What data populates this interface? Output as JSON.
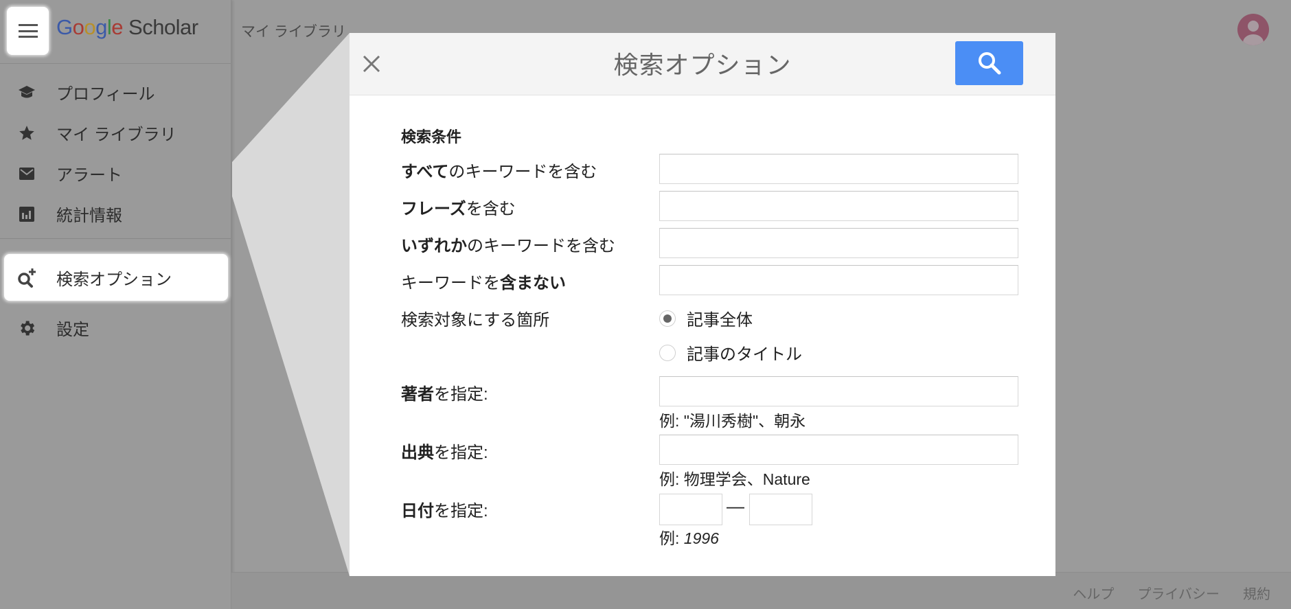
{
  "app": {
    "logo_google": [
      "G",
      "o",
      "o",
      "g",
      "l",
      "e"
    ],
    "logo_product": "Scholar",
    "header_library_link": "マイ ライブラリ"
  },
  "sidebar": {
    "items": [
      {
        "label": "プロフィール",
        "icon": "graduation-cap-icon"
      },
      {
        "label": "マイ ライブラリ",
        "icon": "star-icon"
      },
      {
        "label": "アラート",
        "icon": "envelope-icon"
      },
      {
        "label": "統計情報",
        "icon": "bar-chart-icon"
      },
      {
        "label": "検索オプション",
        "icon": "search-plus-icon",
        "active": true
      },
      {
        "label": "設定",
        "icon": "gear-icon"
      }
    ]
  },
  "footer": {
    "links": [
      "ヘルプ",
      "プライバシー",
      "規約"
    ]
  },
  "modal": {
    "title": "検索オプション",
    "close_icon": "close-icon",
    "search_icon": "search-icon",
    "section_title": "検索条件",
    "fields": [
      {
        "label_bold": "すべて",
        "label_rest": "のキーワードを含む",
        "value": "",
        "placeholder": ""
      },
      {
        "label_bold": "フレーズ",
        "label_rest": "を含む",
        "value": "",
        "placeholder": ""
      },
      {
        "label_bold": "いずれか",
        "label_rest": "のキーワードを含む",
        "value": "",
        "placeholder": ""
      },
      {
        "label_pre": "キーワードを",
        "label_bold": "含まない",
        "value": "",
        "placeholder": ""
      }
    ],
    "scope": {
      "label": "検索対象にする箇所",
      "options": [
        {
          "label": "記事全体",
          "selected": true
        },
        {
          "label": "記事のタイトル",
          "selected": false
        }
      ]
    },
    "author": {
      "label_bold": "著者",
      "label_rest": "を指定:",
      "value": "",
      "hint": "例: \"湯川秀樹\"、朝永"
    },
    "source": {
      "label_bold": "出典",
      "label_rest": "を指定:",
      "value": "",
      "hint": "例: 物理学会、Nature"
    },
    "date": {
      "label_bold": "日付",
      "label_rest": "を指定:",
      "from": "",
      "to": "",
      "separator": "—",
      "hint_prefix": "例: ",
      "hint_value": "1996"
    }
  },
  "colors": {
    "accent": "#4b8ef5",
    "overlay": "#9b9b9b",
    "spotlight": "#d9d9d9",
    "avatar": "#8e5468"
  }
}
